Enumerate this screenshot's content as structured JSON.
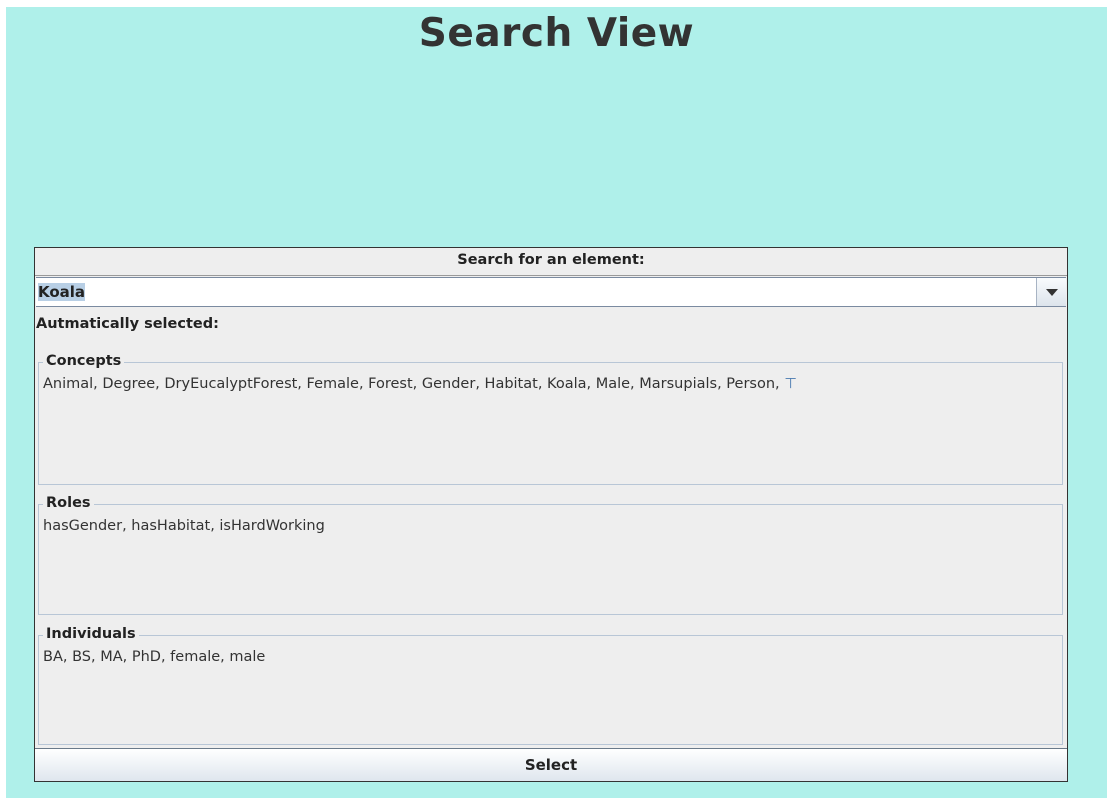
{
  "page": {
    "title": "Search View"
  },
  "search": {
    "header": "Search for an element:",
    "value": "Koala",
    "auto_label": "Autmatically selected:"
  },
  "groups": {
    "concepts": {
      "title": "Concepts",
      "text": "Animal, Degree, DryEucalyptForest, Female, Forest, Gender, Habitat, Koala, Male, Marsupials, Person,",
      "top_symbol": "⊤"
    },
    "roles": {
      "title": "Roles",
      "text": "hasGender, hasHabitat, isHardWorking"
    },
    "individuals": {
      "title": "Individuals",
      "text": "BA, BS, MA, PhD, female, male"
    }
  },
  "actions": {
    "select_label": "Select"
  },
  "icons": {
    "dropdown": "chevron-down-icon"
  },
  "colors": {
    "background": "#aff0ea",
    "panel": "#eeeeee",
    "border": "#333333"
  }
}
